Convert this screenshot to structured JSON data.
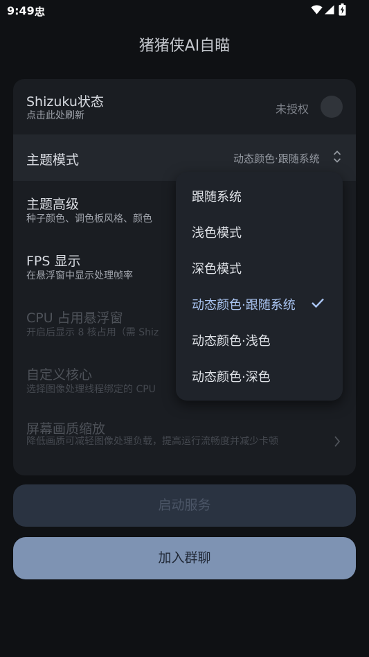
{
  "status_bar": {
    "time": "9:49",
    "notification_icon": "忠"
  },
  "app": {
    "title": "猪猪侠AI自瞄"
  },
  "settings": {
    "shizuku": {
      "title": "Shizuku状态",
      "subtitle": "点击此处刷新",
      "status": "未授权"
    },
    "theme_mode": {
      "title": "主题模式",
      "value": "动态颜色·跟随系统"
    },
    "theme_advanced": {
      "title": "主题高级",
      "subtitle": "种子颜色、调色板风格、颜色"
    },
    "fps": {
      "title": "FPS 显示",
      "subtitle": "在悬浮窗中显示处理帧率"
    },
    "cpu": {
      "title": "CPU 占用悬浮窗",
      "subtitle": "开启后显示 8 核占用（需 Shiz"
    },
    "core": {
      "title": "自定义核心",
      "subtitle": "选择图像处理线程绑定的 CPU"
    },
    "scale": {
      "title": "屏幕画质缩放",
      "subtitle": "降低画质可减轻图像处理负载，提高运行流畅度并减少卡顿"
    }
  },
  "buttons": {
    "start": "启动服务",
    "join": "加入群聊"
  },
  "theme_menu": {
    "items": [
      "跟随系统",
      "浅色模式",
      "深色模式",
      "动态颜色·跟随系统",
      "动态颜色·浅色",
      "动态颜色·深色"
    ],
    "selected": "动态颜色·跟随系统"
  },
  "colors": {
    "background": "#0f1114",
    "accent": "#a9c4f1",
    "join_button": "#7e93b3"
  },
  "icons": {
    "wifi": "wifi-icon",
    "signal": "signal-icon",
    "battery": "battery-charging-icon",
    "check": "check-icon",
    "updown": "unfold-icon",
    "chevron": "chevron-right-icon"
  }
}
